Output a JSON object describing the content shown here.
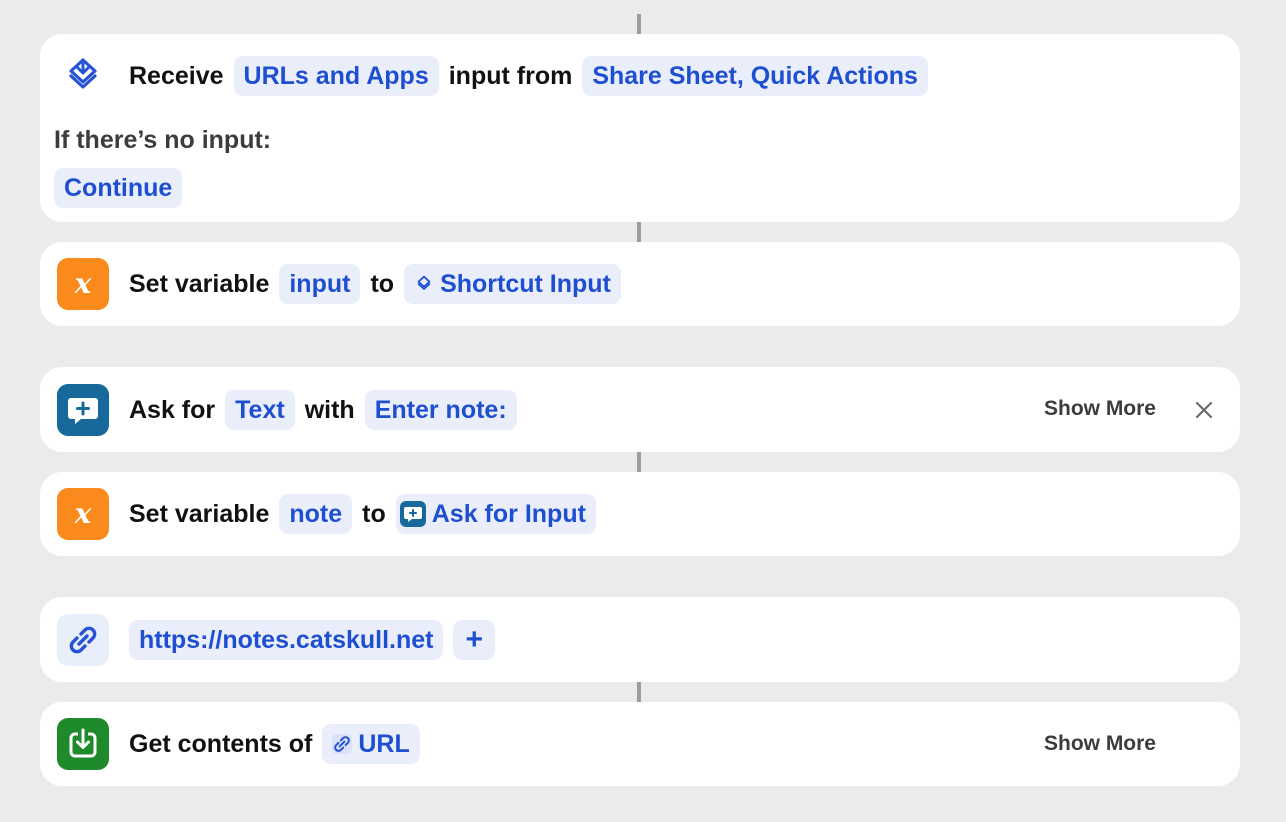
{
  "receive": {
    "label": "Receive",
    "types": "URLs and Apps",
    "mid": "input from",
    "sources": "Share Sheet, Quick Actions",
    "no_input_label": "If there’s no input:",
    "no_input_action": "Continue"
  },
  "set_variable_1": {
    "label": "Set variable",
    "var_name": "input",
    "to": "to",
    "value": "Shortcut Input"
  },
  "ask": {
    "label": "Ask for",
    "type": "Text",
    "with": "with",
    "prompt": "Enter note:",
    "show_more": "Show More"
  },
  "set_variable_2": {
    "label": "Set variable",
    "var_name": "note",
    "to": "to",
    "value": "Ask for Input"
  },
  "url_action": {
    "url": "https://notes.catskull.net",
    "add": "+"
  },
  "get_contents": {
    "label": "Get contents of",
    "value": "URL",
    "show_more": "Show More"
  },
  "colors": {
    "accent_text": "#1f4fd1",
    "pill_bg": "#e9eefa",
    "variable_icon": "#f98a1b",
    "ask_icon": "#16699a",
    "download_icon": "#1f8a2b",
    "background": "#ebebeb"
  },
  "icons": {
    "receive": "shortcut-input-icon",
    "variable": "variable-x-icon",
    "ask": "speech-bubble-plus-icon",
    "url": "link-icon",
    "get_contents": "download-tray-icon",
    "remove": "close-icon"
  }
}
